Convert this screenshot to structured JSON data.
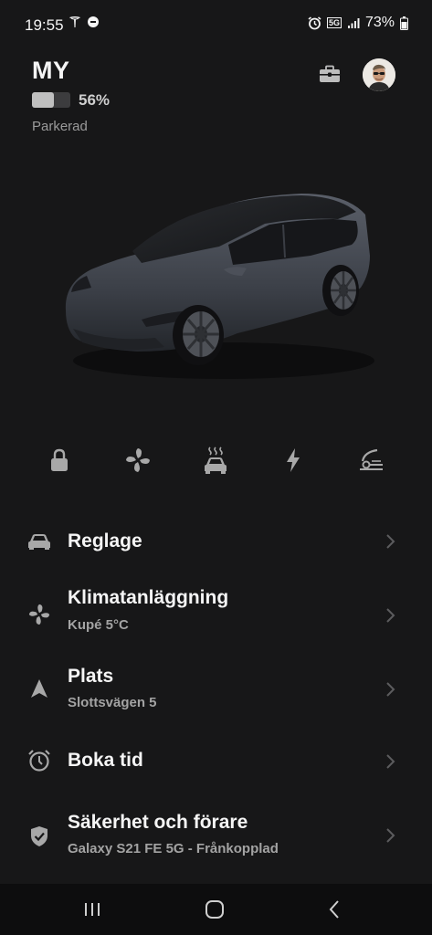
{
  "status_bar": {
    "time": "19:55",
    "battery_percent": "73%",
    "network": "5G",
    "icons": [
      "tesla-icon",
      "media-icon",
      "alarm-icon",
      "signal-icon",
      "battery-icon"
    ]
  },
  "vehicle": {
    "name": "MY",
    "battery_level": "56%",
    "battery_fraction": 0.56,
    "state": "Parkerad"
  },
  "quick_controls": [
    "lock-icon",
    "fan-icon",
    "heated-car-icon",
    "charge-icon",
    "frunk-icon"
  ],
  "menu": {
    "items": [
      {
        "title": "Reglage",
        "subtitle": "",
        "icon": "car-icon"
      },
      {
        "title": "Klimatanläggning",
        "subtitle": "Kupé 5°C",
        "icon": "fan-icon"
      },
      {
        "title": "Plats",
        "subtitle": "Slottsvägen 5",
        "icon": "location-arrow-icon"
      },
      {
        "title": "Boka tid",
        "subtitle": "",
        "icon": "alarm-clock-icon"
      },
      {
        "title": "Säkerhet och förare",
        "subtitle": "Galaxy S21 FE 5G - Frånkopplad",
        "icon": "shield-icon"
      }
    ]
  },
  "colors": {
    "background": "#171718",
    "text": "#f5f5f5",
    "muted": "#9a9a9a",
    "icon": "#a8a8a8"
  }
}
